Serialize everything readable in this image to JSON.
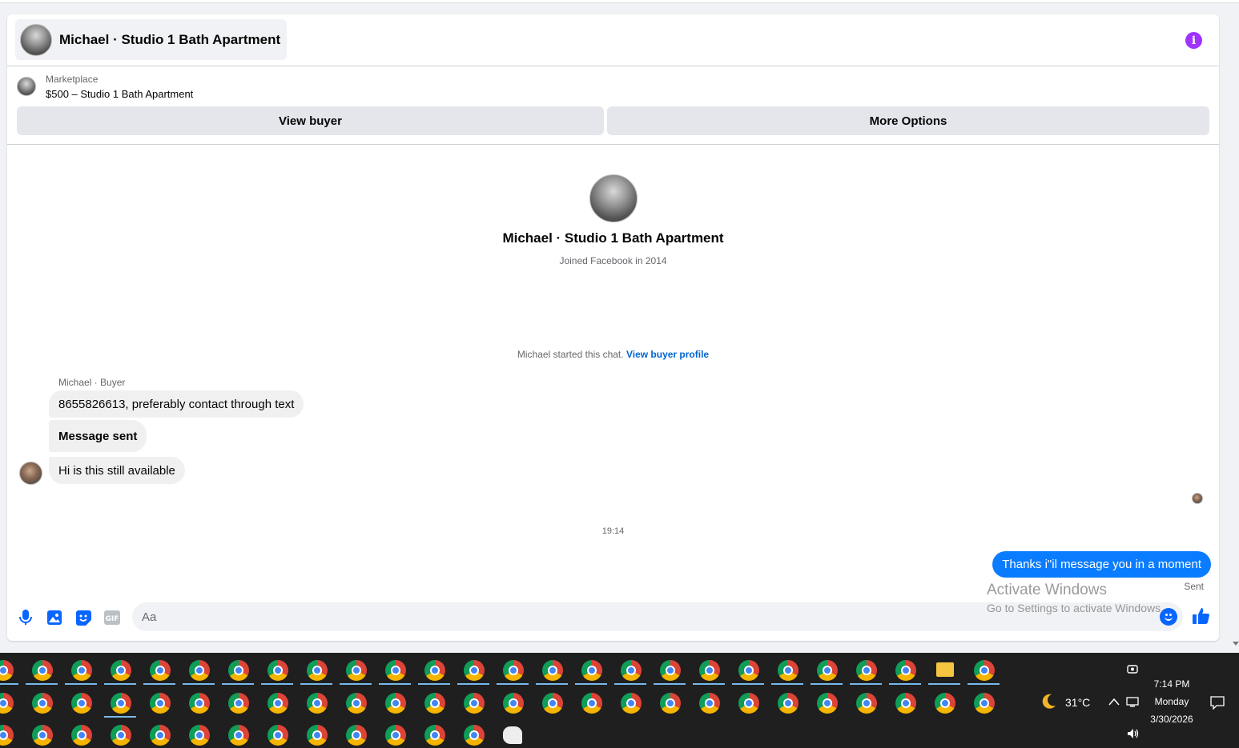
{
  "header": {
    "title": "Michael · Studio 1 Bath Apartment",
    "accent_color": "#a033ff"
  },
  "listing": {
    "source": "Marketplace",
    "title": "$500 – Studio 1 Bath Apartment",
    "view_buyer_label": "View buyer",
    "more_options_label": "More Options"
  },
  "profile": {
    "name": "Michael · Studio 1 Bath Apartment",
    "subtitle": "Joined Facebook in 2014"
  },
  "system": {
    "text": "Michael started this chat.",
    "link_text": "View buyer profile"
  },
  "conversation": {
    "sender_label": "Michael · Buyer",
    "incoming": [
      "8655826613, preferably contact through text",
      "Message sent",
      "Hi is this still available"
    ],
    "timestamp": "19:14",
    "outgoing": "Thanks i\"il message you in a moment",
    "outgoing_status": "Sent",
    "outgoing_color": "#0a7cff"
  },
  "composer": {
    "placeholder": "Aa",
    "icons": [
      "microphone-icon",
      "image-icon",
      "sticker-icon",
      "gif-icon",
      "emoji-icon",
      "thumbs-up-icon"
    ],
    "gif_label": "GIF"
  },
  "watermark": {
    "line1": "Activate Windows",
    "line2": "Go to Settings to activate Windows."
  },
  "taskbar": {
    "temperature": "31°C",
    "time": "7:14 PM",
    "day": "Monday",
    "date": "3/30/2026"
  }
}
